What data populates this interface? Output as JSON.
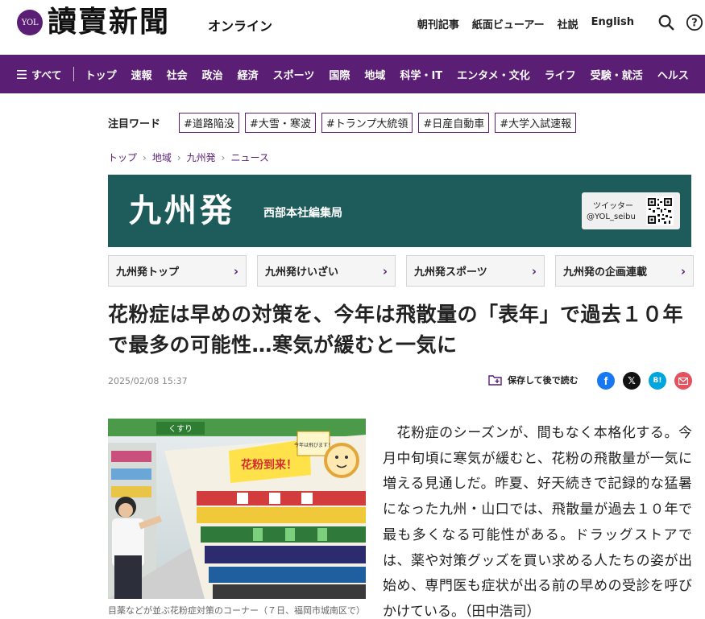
{
  "header": {
    "logo_mark": "YOL",
    "logo_text": "讀賣新聞",
    "logo_sub": "オンライン",
    "links": [
      "朝刊記事",
      "紙面ビューアー",
      "社説",
      "English"
    ],
    "search_icon": "search-icon",
    "help_icon": "help-icon"
  },
  "nav": {
    "all_label": "すべて",
    "items": [
      "トップ",
      "速報",
      "社会",
      "政治",
      "経済",
      "スポーツ",
      "国際",
      "地域",
      "科学・IT",
      "エンタメ・文化",
      "ライフ",
      "受験・就活",
      "ヘルス"
    ]
  },
  "trending": {
    "label": "注目ワード",
    "tags": [
      "#道路陥没",
      "#大雪・寒波",
      "#トランプ大統領",
      "#日産自動車",
      "#大学入試速報"
    ]
  },
  "breadcrumb": [
    "トップ",
    "地域",
    "九州発",
    "ニュース"
  ],
  "banner": {
    "title": "九州発",
    "subtitle": "西部本社編集局",
    "twitter_label": "ツイッター",
    "twitter_handle": "@YOL_seibu"
  },
  "subnav": [
    "九州発トップ",
    "九州発けいざい",
    "九州発スポーツ",
    "九州発の企画連載"
  ],
  "article": {
    "headline": "花粉症は早めの対策を、今年は飛散量の「表年」で過去１０年で最多の可能性…寒気が緩むと一気に",
    "date": "2025/02/08 15:37",
    "save_label": "保存して後で読む",
    "caption": "目薬などが並ぶ花粉症対策のコーナー（７日、福岡市城南区で）",
    "body": "　花粉症のシーズンが、間もなく本格化する。今月中旬頃に寒気が緩むと、花粉の飛散量が一気に増える見通しだ。昨夏、好天続きで記録的な猛暑になった九州・山口では、飛散量が過去１０年で最も多くなる可能性がある。ドラッグストアでは、薬や対策グッズを買い求める人たちの姿が出始め、専門医も症状が出る前の早めの受診を呼びかけている。（田中浩司）",
    "photo_texts": {
      "shop_sign": "くすり",
      "pop_main": "花粉到来！",
      "pop_small": "今年は飛びます！"
    }
  },
  "social": [
    "facebook-icon",
    "x-icon",
    "hatena-icon",
    "mail-icon"
  ],
  "colors": {
    "brand": "#5a1e74",
    "banner": "#1d5c5a"
  }
}
